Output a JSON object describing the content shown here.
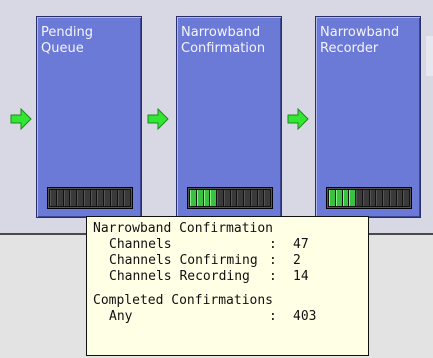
{
  "stages": [
    {
      "title": "Pending\nQueue",
      "meter_filled_segments": 0,
      "meter_total_segments": 12
    },
    {
      "title": "Narrowband\nConfirmation",
      "meter_filled_segments": 4,
      "meter_total_segments": 12
    },
    {
      "title": "Narrowband\nRecorder",
      "meter_filled_segments": 4,
      "meter_total_segments": 12
    }
  ],
  "colors": {
    "stage_fill": "#6b7ad6",
    "arrow": "#34e634",
    "meter_on": "#39c23f",
    "tooltip_bg": "#ffffe6"
  },
  "tooltip": {
    "title": "Narrowband Confirmation",
    "rows": [
      {
        "label": "Channels",
        "value": "47"
      },
      {
        "label": "Channels Confirming",
        "value": "2"
      },
      {
        "label": "Channels Recording",
        "value": "14"
      }
    ],
    "section2_title": "Completed Confirmations",
    "rows2": [
      {
        "label": "Any",
        "value": "403"
      }
    ]
  }
}
